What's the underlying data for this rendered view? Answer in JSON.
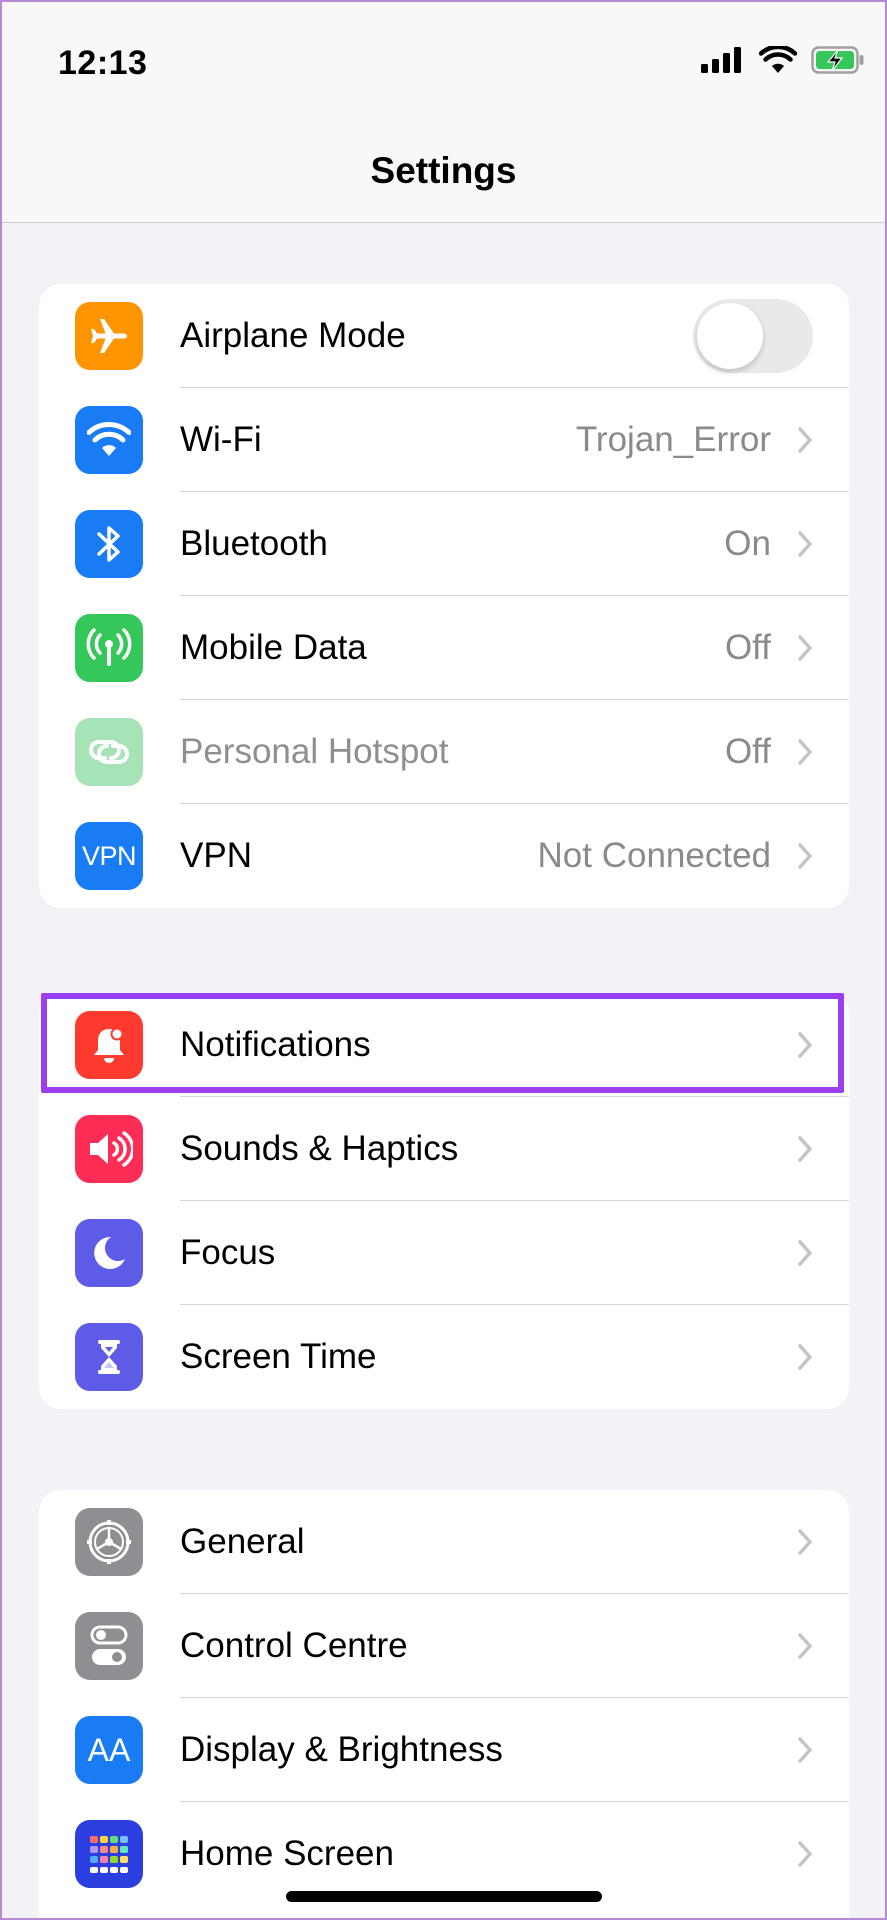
{
  "status_bar": {
    "time": "12:13",
    "signal_icon": "signal-bars-icon",
    "wifi_icon": "wifi-icon",
    "battery_icon": "battery-charging-icon"
  },
  "nav": {
    "title": "Settings"
  },
  "colors": {
    "orange": "#ff9500",
    "blue": "#1a7cf5",
    "green": "#34c759",
    "green_dim": "#a6e3b6",
    "red": "#ff3b30",
    "pink": "#ff2d55",
    "indigo": "#5e5ce6",
    "gray": "#8e8e93",
    "highlight": "#9a3ef0"
  },
  "group1": {
    "rows": [
      {
        "label": "Airplane Mode",
        "icon": "airplane-icon",
        "toggle_on": false
      },
      {
        "label": "Wi-Fi",
        "value": "Trojan_Error",
        "icon": "wifi-icon"
      },
      {
        "label": "Bluetooth",
        "value": "On",
        "icon": "bluetooth-icon"
      },
      {
        "label": "Mobile Data",
        "value": "Off",
        "icon": "antenna-icon"
      },
      {
        "label": "Personal Hotspot",
        "value": "Off",
        "icon": "hotspot-link-icon"
      },
      {
        "label": "VPN",
        "value": "Not Connected",
        "icon": "vpn-icon",
        "icon_text": "VPN"
      }
    ]
  },
  "group2": {
    "rows": [
      {
        "label": "Notifications",
        "icon": "notification-bell-icon"
      },
      {
        "label": "Sounds & Haptics",
        "icon": "speaker-icon"
      },
      {
        "label": "Focus",
        "icon": "moon-icon"
      },
      {
        "label": "Screen Time",
        "icon": "hourglass-icon"
      }
    ]
  },
  "group3": {
    "rows": [
      {
        "label": "General",
        "icon": "gear-icon"
      },
      {
        "label": "Control Centre",
        "icon": "toggles-icon"
      },
      {
        "label": "Display & Brightness",
        "icon": "text-size-icon",
        "icon_text": "AA"
      },
      {
        "label": "Home Screen",
        "icon": "app-grid-icon"
      }
    ]
  }
}
